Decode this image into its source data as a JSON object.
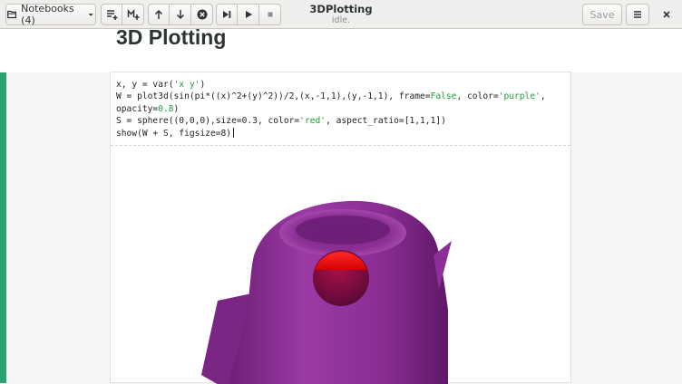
{
  "header": {
    "notebooks_label": "Notebooks (4)",
    "title": "3DPlotting",
    "status": "idle.",
    "save_label": "Save"
  },
  "notebook": {
    "heading": "3D Plotting"
  },
  "cell": {
    "code_lines": [
      "x, y = var('x y')",
      "W = plot3d(sin(pi*((x)^2+(y)^2))/2,(x,-1,1),(y,-1,1), frame=False, color='purple',",
      "opacity=0.8)",
      "S = sphere((0,0,0),size=0.3, color='red', aspect_ratio=[1,1,1])",
      "show(W + S, figsize=8) "
    ]
  },
  "colors": {
    "accent_bar": "#2ba36f",
    "surface": "#8e2f97",
    "sphere": "#e00000",
    "string_literal": "#1f9d3a"
  },
  "icons": {
    "notebooks": "notebooks-icon",
    "dropdown": "chevron-down-icon",
    "add_cell": "add-cell-icon",
    "add_markdown": "add-markdown-icon",
    "move_up": "arrow-up-icon",
    "move_down": "arrow-down-icon",
    "delete": "delete-cell-icon",
    "run_to_end": "skip-forward-icon",
    "run": "play-icon",
    "stop": "stop-icon",
    "menu": "hamburger-menu-icon",
    "close": "close-icon"
  }
}
